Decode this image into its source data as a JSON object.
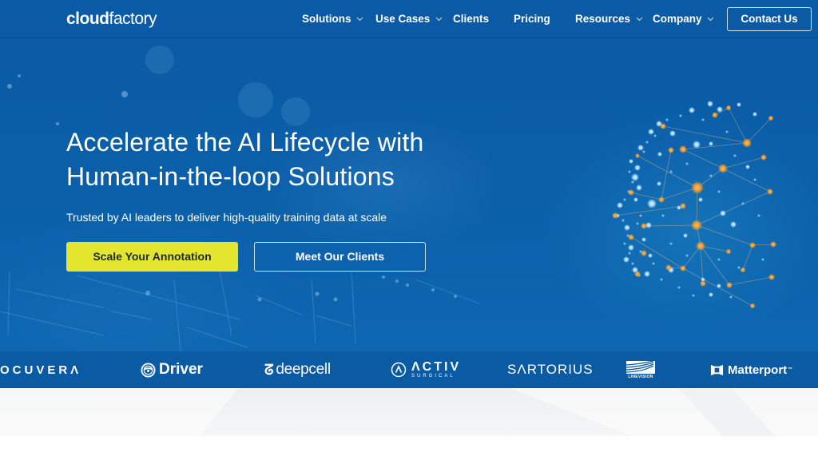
{
  "brand": {
    "logo_bold": "cloud",
    "logo_light": "factory"
  },
  "nav": {
    "items": [
      {
        "label": "Solutions",
        "has_dropdown": true
      },
      {
        "label": "Use Cases",
        "has_dropdown": true
      },
      {
        "label": "Clients",
        "has_dropdown": false
      },
      {
        "label": "Pricing",
        "has_dropdown": false
      },
      {
        "label": "Resources",
        "has_dropdown": true
      },
      {
        "label": "Company",
        "has_dropdown": true
      }
    ],
    "contact_label": "Contact Us"
  },
  "hero": {
    "headline_line1": "Accelerate the AI Lifecycle with",
    "headline_line2": "Human-in-the-loop Solutions",
    "subheadline": "Trusted by AI leaders to deliver high-quality training data at scale",
    "primary_cta": "Scale Your Annotation",
    "secondary_cta": "Meet Our Clients",
    "image_icon": "ai-face-network-icon"
  },
  "clients": {
    "logos": [
      {
        "name": "OCUVERA",
        "text": "OCUVERΛ"
      },
      {
        "name": "Driver",
        "text": "Driver",
        "icon": "steering-wheel-icon"
      },
      {
        "name": "deepcell",
        "text": "deepcell",
        "mark": "ᘔ"
      },
      {
        "name": "Activ Surgical",
        "text": "ΛCTIV",
        "subtext": "SURGICAL",
        "icon": "activ-circle-icon"
      },
      {
        "name": "Sartorius",
        "text": "SΛRTORIUS"
      },
      {
        "name": "LineVision",
        "text": "LINEVISION",
        "icon": "linevision-wave-icon"
      },
      {
        "name": "Matterport",
        "text": "Matterport",
        "trademark": "™",
        "icon": "matterport-icon"
      }
    ]
  },
  "colors": {
    "brand_blue": "#0a5aa5",
    "cta_yellow": "#e3e52e",
    "node_orange": "#f39a2a",
    "node_blue": "#9fd4ff"
  }
}
